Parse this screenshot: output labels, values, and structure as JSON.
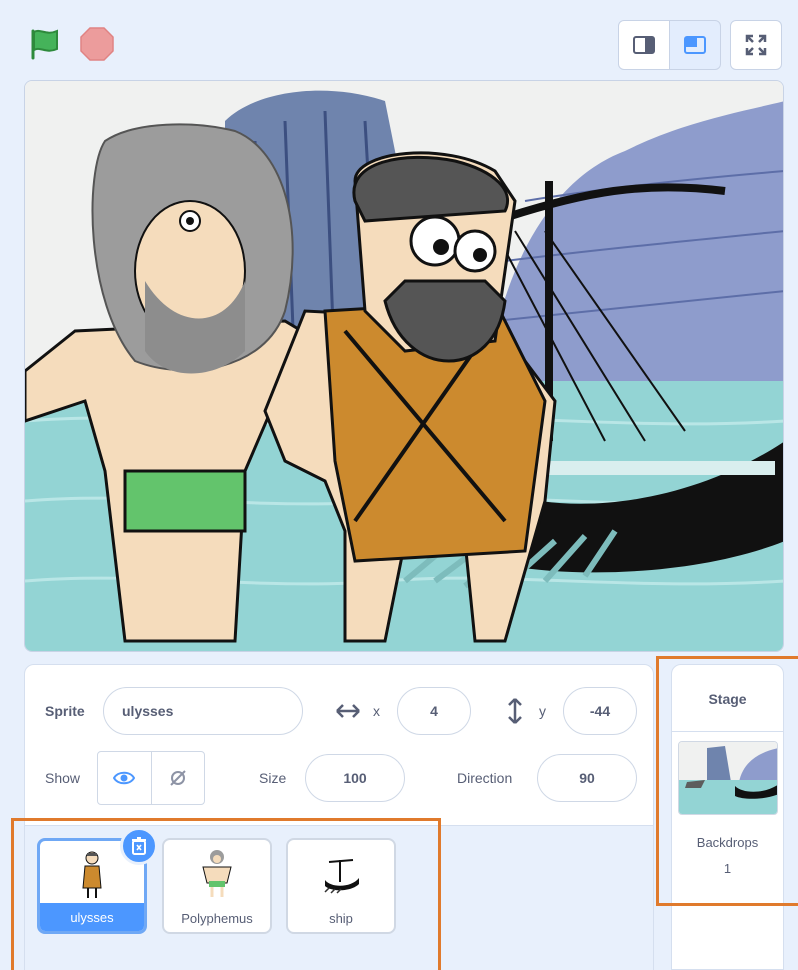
{
  "controls": {
    "green_flag_icon": "green-flag",
    "stop_icon": "stop-sign",
    "small_stage_icon": "small-stage-layout",
    "large_stage_icon": "large-stage-layout",
    "fullscreen_icon": "fullscreen"
  },
  "sprite_info": {
    "sprite_label": "Sprite",
    "sprite_name": "ulysses",
    "x_label": "x",
    "x_value": "4",
    "y_label": "y",
    "y_value": "-44",
    "show_label": "Show",
    "size_label": "Size",
    "size_value": "100",
    "direction_label": "Direction",
    "direction_value": "90"
  },
  "sprites": [
    {
      "name": "ulysses",
      "selected": true
    },
    {
      "name": "Polyphemus",
      "selected": false
    },
    {
      "name": "ship",
      "selected": false
    }
  ],
  "stage_pane": {
    "title": "Stage",
    "backdrops_label": "Backdrops",
    "backdrops_count": "1"
  },
  "colors": {
    "accent": "#4c97ff",
    "highlight": "#e07a2c",
    "flag": "#45b35a",
    "stop": "#ec9c9c"
  }
}
